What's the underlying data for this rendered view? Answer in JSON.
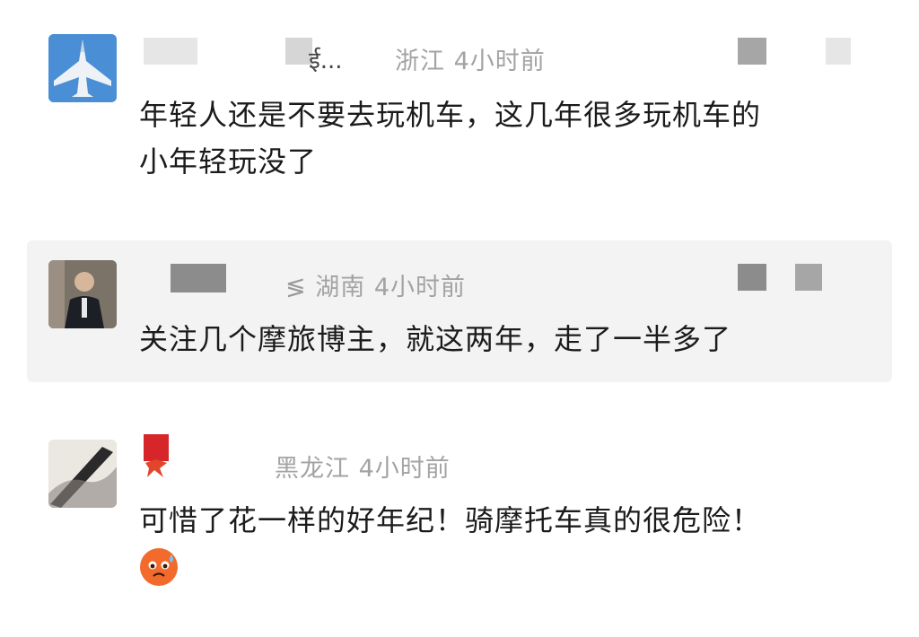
{
  "comments": [
    {
      "truncated_name_suffix": "ई...",
      "location": "浙江",
      "time": "4小时前",
      "text_line1": "年轻人还是不要去玩机车，这几年很多玩机车的",
      "text_line2": "小年轻玩没了",
      "avatar_icon": "fighter-jet-avatar"
    },
    {
      "location": "湖南",
      "time": "4小时前",
      "text_line1": "关注几个摩旅博主，就这两年，走了一半多了",
      "avatar_icon": "person-photo-avatar"
    },
    {
      "location": "黑龙江",
      "time": "4小时前",
      "text_line1": "可惜了花一样的好年纪！骑摩托车真的很危险！",
      "avatar_icon": "brush-painting-avatar",
      "emoji": "sad-sweat-emoji"
    }
  ],
  "colors": {
    "meta_text": "#a3a3a3",
    "body_text": "#1b1b1b",
    "highlight_bg": "#f3f3f3"
  }
}
